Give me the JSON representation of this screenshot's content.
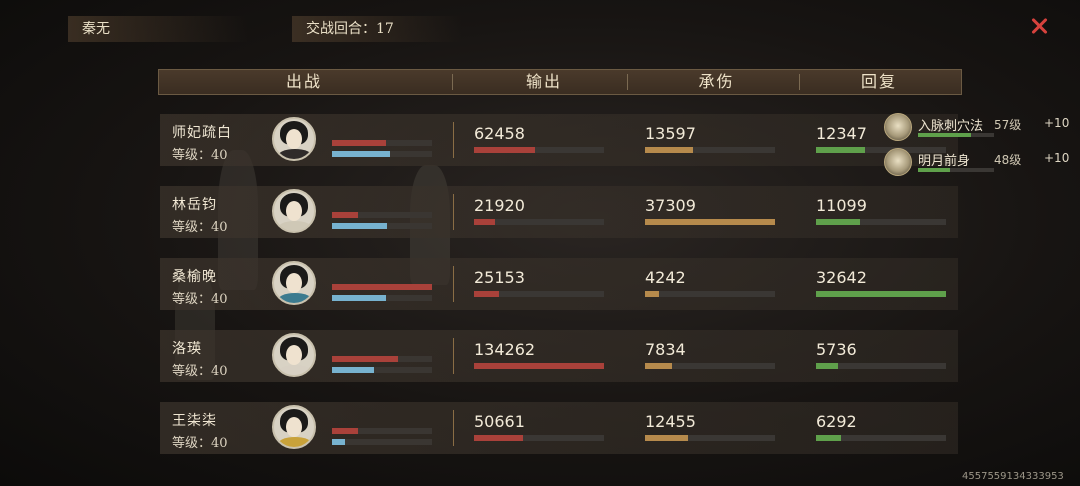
{
  "top": {
    "name": "秦无",
    "round_label": "交战回合：17"
  },
  "table": {
    "headers": [
      "出战",
      "输出",
      "承伤",
      "回复"
    ],
    "rows": [
      {
        "name": "师妃疏白",
        "level": "等级：40",
        "output": "62458",
        "output_frac": 0.47,
        "taken": "13597",
        "taken_frac": 0.37,
        "heal": "12347",
        "heal_frac": 0.38,
        "mini_red": 0.54,
        "mini_blue": 0.58,
        "robe": "#2f2b2a"
      },
      {
        "name": "林岳钧",
        "level": "等级：40",
        "output": "21920",
        "output_frac": 0.16,
        "taken": "37309",
        "taken_frac": 1.0,
        "heal": "11099",
        "heal_frac": 0.34,
        "mini_red": 0.26,
        "mini_blue": 0.55,
        "robe": "#cfc8b6"
      },
      {
        "name": "桑榆晚",
        "level": "等级：40",
        "output": "25153",
        "output_frac": 0.19,
        "taken": "4242",
        "taken_frac": 0.11,
        "heal": "32642",
        "heal_frac": 1.0,
        "mini_red": 1.0,
        "mini_blue": 0.54,
        "robe": "#3c7b8f"
      },
      {
        "name": "洛瑛",
        "level": "等级：40",
        "output": "134262",
        "output_frac": 1.0,
        "taken": "7834",
        "taken_frac": 0.21,
        "heal": "5736",
        "heal_frac": 0.17,
        "mini_red": 0.66,
        "mini_blue": 0.42,
        "robe": "#d7d0c3"
      },
      {
        "name": "王柒柒",
        "level": "等级：40",
        "output": "50661",
        "output_frac": 0.38,
        "taken": "12455",
        "taken_frac": 0.33,
        "heal": "6292",
        "heal_frac": 0.19,
        "mini_red": 0.26,
        "mini_blue": 0.13,
        "robe": "#c9a23a"
      }
    ]
  },
  "skills": [
    {
      "name": "入脉刺穴法",
      "level": "57级",
      "bonus": "+10",
      "progress": 0.7
    },
    {
      "name": "明月前身",
      "level": "48级",
      "bonus": "+10",
      "progress": 0.42
    }
  ],
  "uid": "4557559134333953",
  "colors": {
    "output": "#a9413a",
    "taken": "#b68a4c",
    "heal": "#5fa04b",
    "hp": "#77b2cf",
    "close": "#d6423d"
  }
}
